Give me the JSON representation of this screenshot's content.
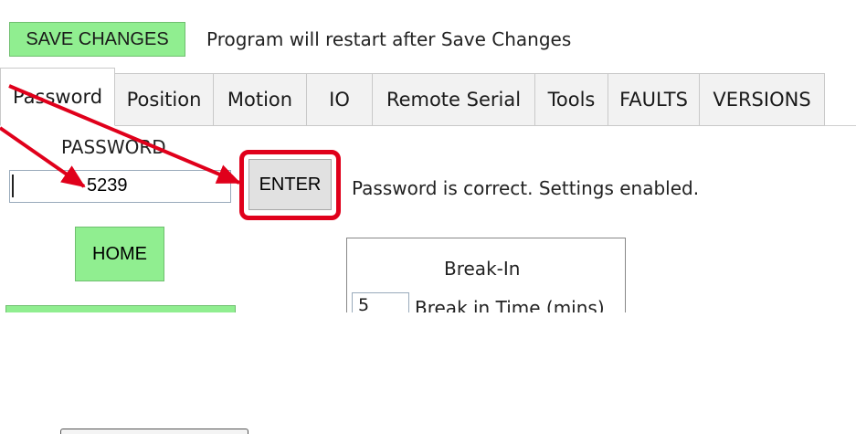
{
  "header": {
    "save_button": "SAVE CHANGES",
    "restart_note": "Program will restart after Save Changes"
  },
  "tabs": [
    {
      "label": "Password",
      "active": true
    },
    {
      "label": "Position"
    },
    {
      "label": "Motion"
    },
    {
      "label": "IO"
    },
    {
      "label": "Remote Serial"
    },
    {
      "label": "Tools"
    },
    {
      "label": "FAULTS"
    },
    {
      "label": "VERSIONS"
    }
  ],
  "password": {
    "label": "PASSWORD",
    "value": "5239",
    "enter_button": "ENTER",
    "status": "Password is correct. Settings enabled."
  },
  "home_button": "HOME",
  "break_in": {
    "title": "Break-In",
    "time_value": "5",
    "time_label": "Break in Time (mins)"
  },
  "colors": {
    "green_button": "#90ee90",
    "annotation_red": "#e0001b"
  }
}
